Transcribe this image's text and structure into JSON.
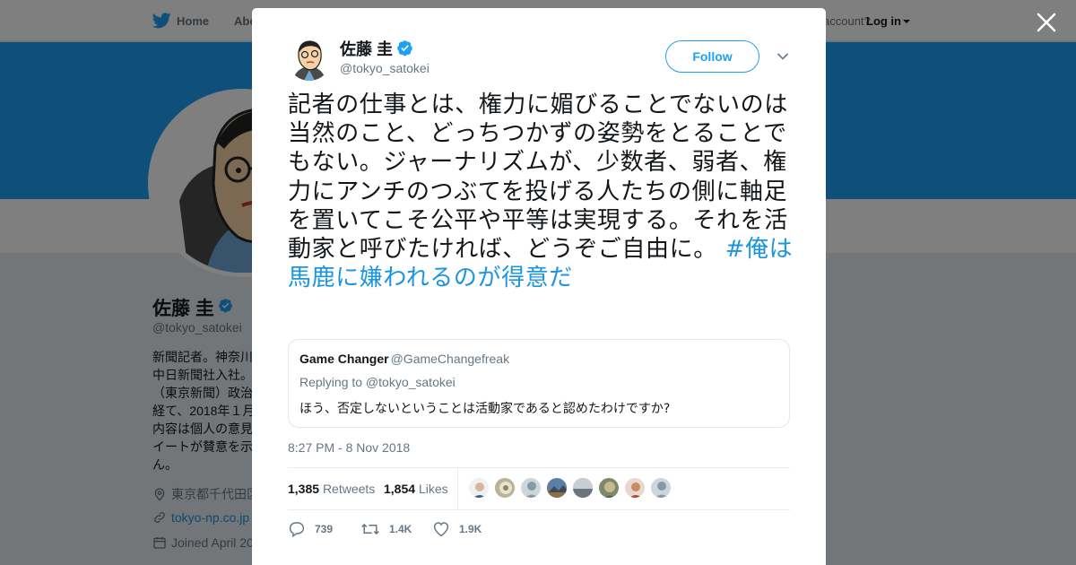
{
  "nav": {
    "home_label": "Home",
    "about_label": "Abo",
    "account_prompt": "account?",
    "login_label": "Log in"
  },
  "profile": {
    "name": "佐藤 圭",
    "handle": "@tokyo_satokei",
    "bio": "新聞記者。神奈川中日新聞社入社。（東京新聞）政治経て、2018年１月内容は個人の意見イートが賛意を示ん。",
    "location": "東京都千代田区",
    "website": "tokyo-np.co.jp",
    "joined": "Joined April 20"
  },
  "tweet": {
    "author_name": "佐藤 圭",
    "author_handle": "@tokyo_satokei",
    "follow_label": "Follow",
    "text": "記者の仕事とは、権力に媚びることでないのは当然のこと、どっちつかずの姿勢をとることでもない。ジャーナリズムが、少数者、弱者、権力にアンチのつぶてを投げる人たちの側に軸足を置いてこそ公平や平等は実現する。それを活動家と呼びたければ、どうぞご自由に。",
    "hashtag": "#俺は馬鹿に嫌われるのが得意だ",
    "timestamp": "8:27 PM - 8 Nov 2018",
    "retweets_count": "1,385",
    "retweets_label": "Retweets",
    "likes_count": "1,854",
    "likes_label": "Likes",
    "reply_count": "739",
    "retweet_count_short": "1.4K",
    "like_count_short": "1.9K"
  },
  "quoted": {
    "name": "Game Changer",
    "handle": "@GameChangefreak",
    "replying_to": "Replying to @tokyo_satokei",
    "text": "ほう、否定しないということは活動家であると認めたわけですか?"
  },
  "colors": {
    "accent": "#1da1f2",
    "link": "#1b95e0",
    "muted": "#657786"
  },
  "icons": [
    "twitter-bird-icon",
    "verified-badge-icon",
    "close-icon",
    "chevron-down-icon",
    "reply-icon",
    "retweet-icon",
    "heart-icon",
    "location-icon",
    "link-icon",
    "calendar-icon"
  ]
}
